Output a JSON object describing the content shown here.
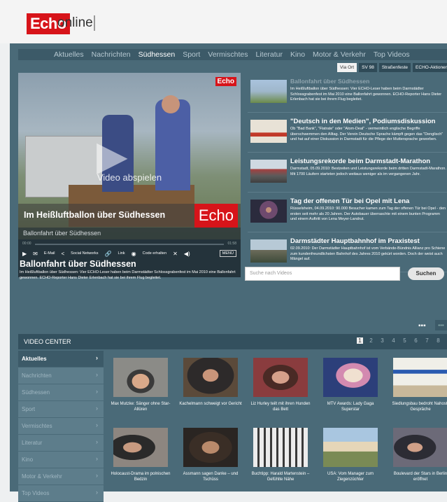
{
  "brand": {
    "name": "Echo",
    "suffix": "online"
  },
  "nav": [
    "Aktuelles",
    "Nachrichten",
    "Südhessen",
    "Sport",
    "Vermischtes",
    "Literatur",
    "Kino",
    "Motor & Verkehr",
    "Top Videos"
  ],
  "nav_active": "Südhessen",
  "subtabs": [
    "Via Ort",
    "SV 98",
    "Straßenfeste",
    "ECHO-Aktionen"
  ],
  "subtab_active": "Via Ort",
  "player": {
    "logo": "Echo",
    "play_label": "Video abspielen",
    "banner_text": "Im Heißluftballon über Südhessen",
    "banner_logo": "Echo",
    "caption": "Ballonfahrt über Südhessen",
    "time_start": "00:00",
    "time_end": "01:58",
    "controls": {
      "email": "E-Mail",
      "social": "Social Networks",
      "link": "Link",
      "code": "Code erhalten",
      "menu": "MENÜ"
    }
  },
  "video": {
    "title": "Ballonfahrt über Südhessen",
    "desc": "Im Heißluftballon über Südhessen: Vier ECHO-Leser haben beim Darmstädter Schlossgrabenfest im Mai 2010 eine Ballonfahrt gewonnen. ECHO-Reporter Hans Dieter Erlenbach hat sie bei ihrem Flug begleitet."
  },
  "news": [
    {
      "title": "Ballonfahrt über Südhessen",
      "text": "Im Heißluftballon über Südhessen: Vier ECHO-Leser haben beim Darmstädter Schlossgrabenfest im Mai 2010 eine Ballonfahrt gewonnen. ECHO-Reporter Hans Dieter Erlenbach hat sie bei ihrem Flug begleitet."
    },
    {
      "title": "\"Deutsch in den Medien\", Podiumsdiskussion",
      "text": "Ob \"Bad Bank\", \"Flatrate\" oder \"Atom-Deal\" - vermeintlich englische Begriffe überschwemmen den Alltag. Der Verein Deutsche Sprache kämpft gegen das \"Denglisch\" und hat auf einer Diskussion in Darmstadt für die Pflege der Muttersprache geworben."
    },
    {
      "title": "Leistungsrekorde beim Darmstadt-Marathon",
      "text": "Darmstadt, 05.09.2010: Bestzeiten und Leistungsrekorde beim dritten Darmstadt-Marathon. Mit 1700 Läufern starteten jedoch weitaus weniger als im vergangenen Jahr."
    },
    {
      "title": "Tag der offenen Tür bei Opel mit Lena",
      "text": "Rüsselsheim, 04.09.2010: 90.000 Besucher kamen zum Tag der offenen Tür bei Opel - den ersten seit mehr als 20 Jahren. Der Autobauer überraschte mit einem bunten Programm und einem Auftritt von Lena Meyer-Landrut."
    },
    {
      "title": "Darmstädter Hauptbahnhof im Praxistest",
      "text": "02.09.2010: Der Darmstädter Hauptbahnhof ist vom Verbände-Bündnis Allianz pro Schiene zum kundenfreundlichsten Bahnhof des Jahres 2010 gekürt worden. Doch der weist auch Mängel auf."
    }
  ],
  "search": {
    "placeholder": "Suche nach Videos",
    "button": "Suchen"
  },
  "video_center": {
    "title": "VIDEO CENTER",
    "pages": [
      "1",
      "2",
      "3",
      "4",
      "5",
      "6",
      "7",
      "8",
      "9",
      "10"
    ],
    "active_page": "1",
    "categories": [
      "Aktuelles",
      "Nachrichten",
      "Südhessen",
      "Sport",
      "Vermischtes",
      "Literatur",
      "Kino",
      "Motor & Verkehr",
      "Top Videos"
    ],
    "active_category": "Aktuelles",
    "videos": [
      "Max Mutzke: Sänger ohne Star-Allüren",
      "Kachelmann schweigt vor Gericht",
      "Liz Hurley teilt mit ihren Hunden das Bett",
      "MTV Awards: Lady Gaga Superstar",
      "Siedlungsbau bedroht Nahost-Gespräche",
      "Holocaust-Drama im polnischen Bedzin",
      "Assmann sagen Danke – und Tschüss",
      "Buchtipp: Harald Martenstein – Gefühlte Nähe",
      "USA: Vom Manager zum Ziegenzüchter",
      "Boulevard der Stars in Berlin eröffnet"
    ]
  },
  "colors": {
    "brand_red": "#d7141a",
    "panel": "#4a6a78",
    "nav": "#3c5a68"
  }
}
